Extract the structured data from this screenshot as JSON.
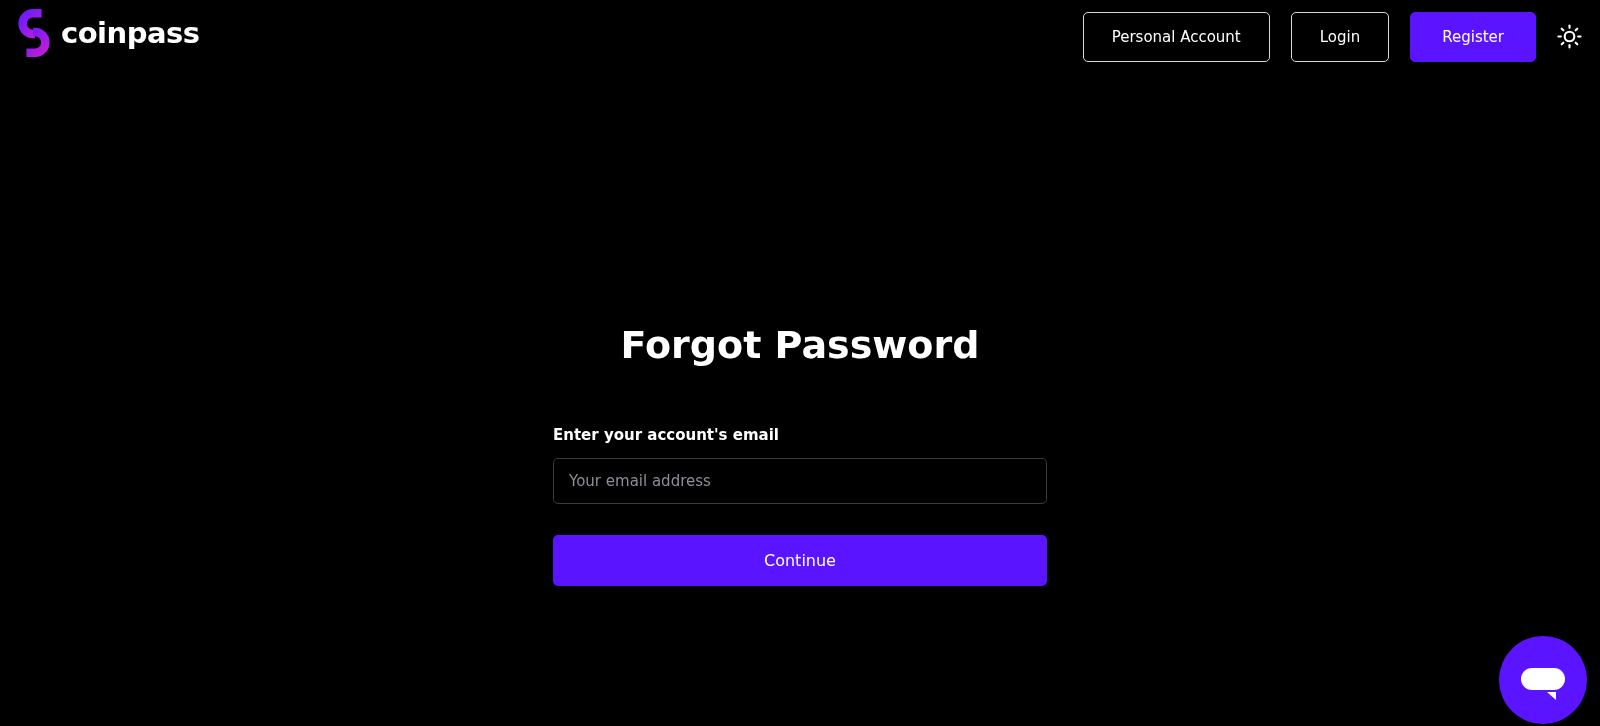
{
  "header": {
    "logo": {
      "text": "coinpass"
    },
    "buttons": [
      {
        "label": "Personal Account",
        "kind": "outline"
      },
      {
        "label": "Login",
        "kind": "outline"
      },
      {
        "label": "Register",
        "kind": "primary"
      }
    ]
  },
  "form": {
    "title": "Forgot Password",
    "field": {
      "label": "Enter your account's email",
      "placeholder": "Your email address"
    },
    "submit": "Continue"
  }
}
